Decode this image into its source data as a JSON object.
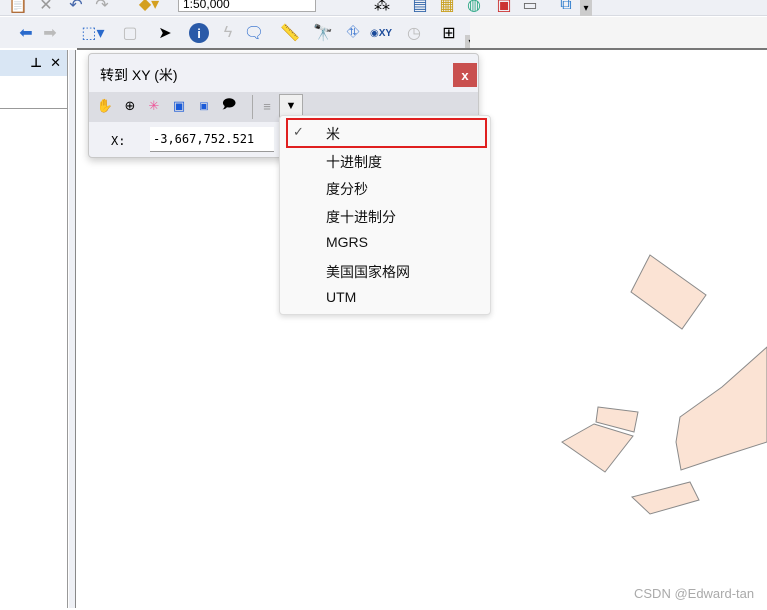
{
  "toolbar": {
    "scale_value": "1:50,000"
  },
  "left_panel": {
    "pin_icon": "pin-icon",
    "close_label": "✕"
  },
  "dialog": {
    "title": "转到 XY  (米)",
    "close_label": "x",
    "x_label": "X:",
    "x_value": "-3,667,752.521"
  },
  "units_menu": {
    "selected": "米",
    "items": [
      "米",
      "十进制度",
      "度分秒",
      "度十进制分",
      "MGRS",
      "美国国家格网",
      "UTM"
    ]
  },
  "colors": {
    "polygon_fill": "#fbe3d4",
    "polygon_stroke": "#8a8a8a",
    "close_bg": "#c9504f",
    "highlight": "#e02020"
  },
  "watermark": "CSDN @Edward-tan"
}
